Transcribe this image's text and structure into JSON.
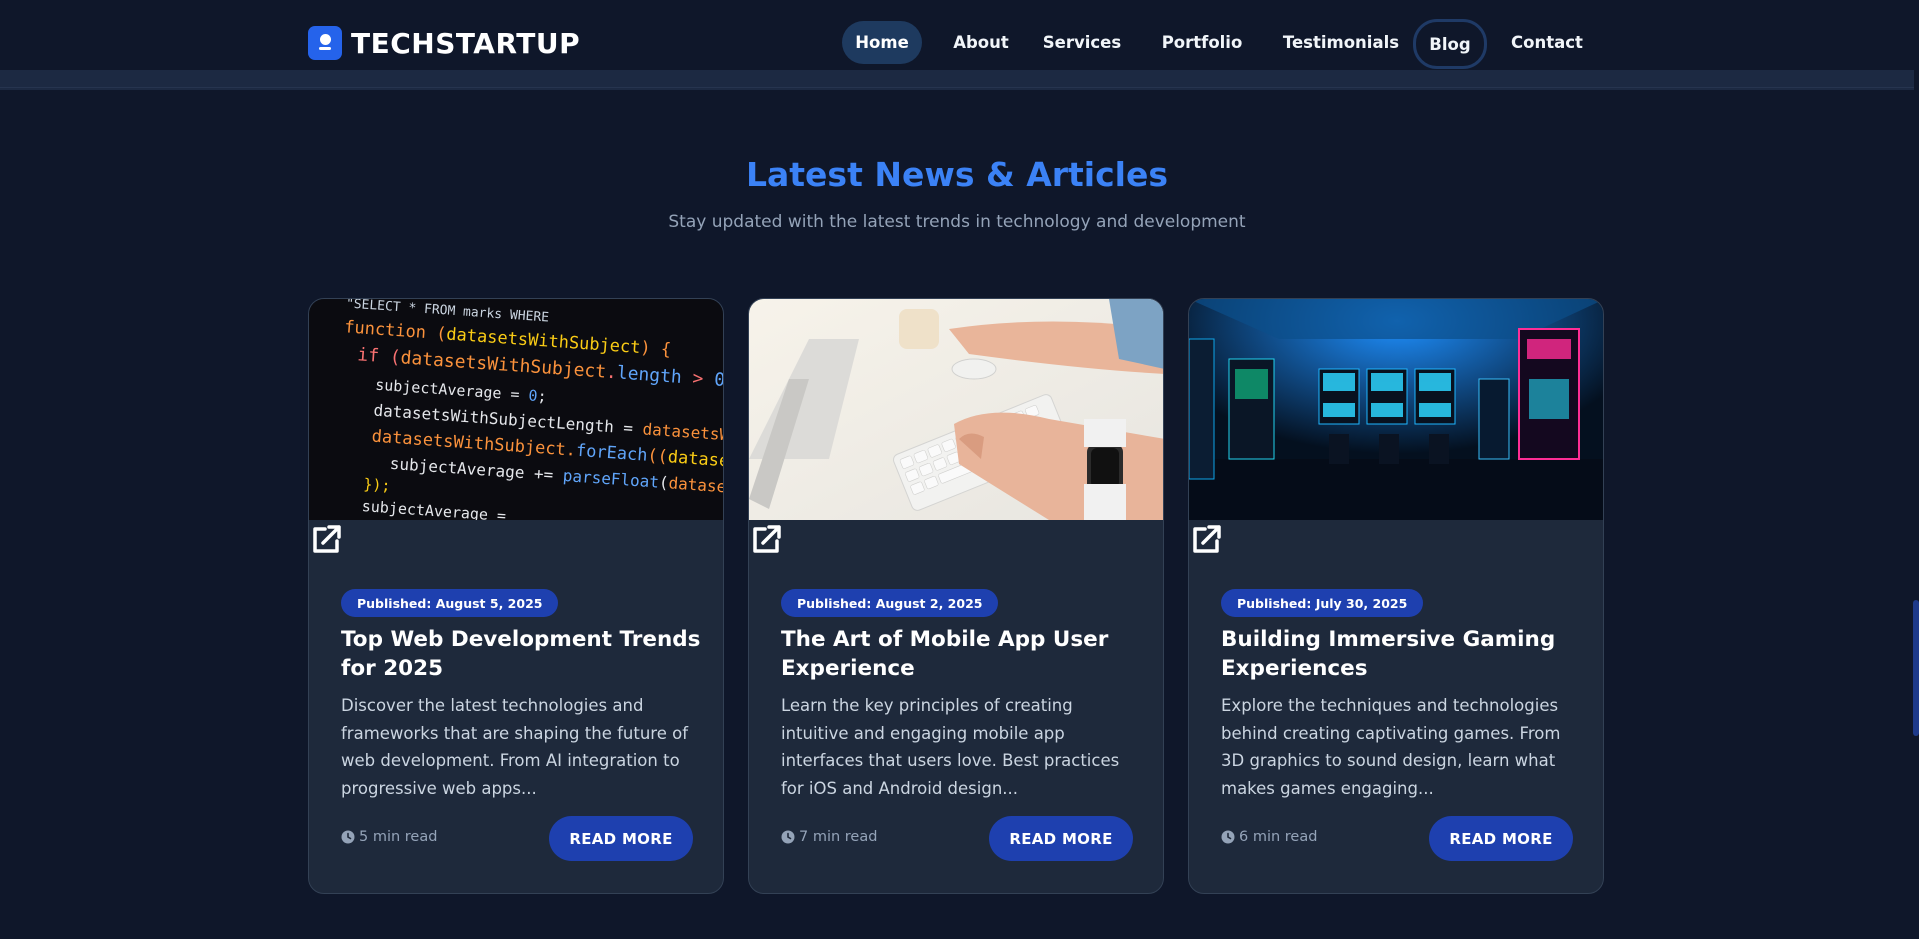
{
  "header": {
    "logo_text": "TECHSTARTUP",
    "nav": [
      "Home",
      "About",
      "Services",
      "Portfolio",
      "Testimonials",
      "Blog",
      "Contact"
    ],
    "active_item": "Home",
    "focused_item": "Blog"
  },
  "section": {
    "title": "Latest News & Articles",
    "subtitle": "Stay updated with the latest trends in technology and development"
  },
  "posts": [
    {
      "date": "Published: August 5, 2025",
      "title": "Top Web Development Trends for 2025",
      "excerpt": "Discover the latest technologies and frameworks that are shaping the future of web development. From AI integration to progressive web apps...",
      "read_time": "5 min read",
      "button": "READ MORE",
      "image": "code-editor-photo"
    },
    {
      "date": "Published: August 2, 2025",
      "title": "The Art of Mobile App User Experience",
      "excerpt": "Learn the key principles of creating intuitive and engaging mobile app interfaces that users love. Best practices for iOS and Android design...",
      "read_time": "7 min read",
      "button": "READ MORE",
      "image": "keyboard-typing-photo"
    },
    {
      "date": "Published: July 30, 2025",
      "title": "Building Immersive Gaming Experiences",
      "excerpt": "Explore the techniques and technologies behind creating captivating games. From 3D graphics to sound design, learn what makes games engaging...",
      "read_time": "6 min read",
      "button": "READ MORE",
      "image": "arcade-room-photo"
    }
  ],
  "colors": {
    "background": "#0f172a",
    "card": "#1e293b",
    "accent": "#3b82f6",
    "button": "#1e40af"
  }
}
